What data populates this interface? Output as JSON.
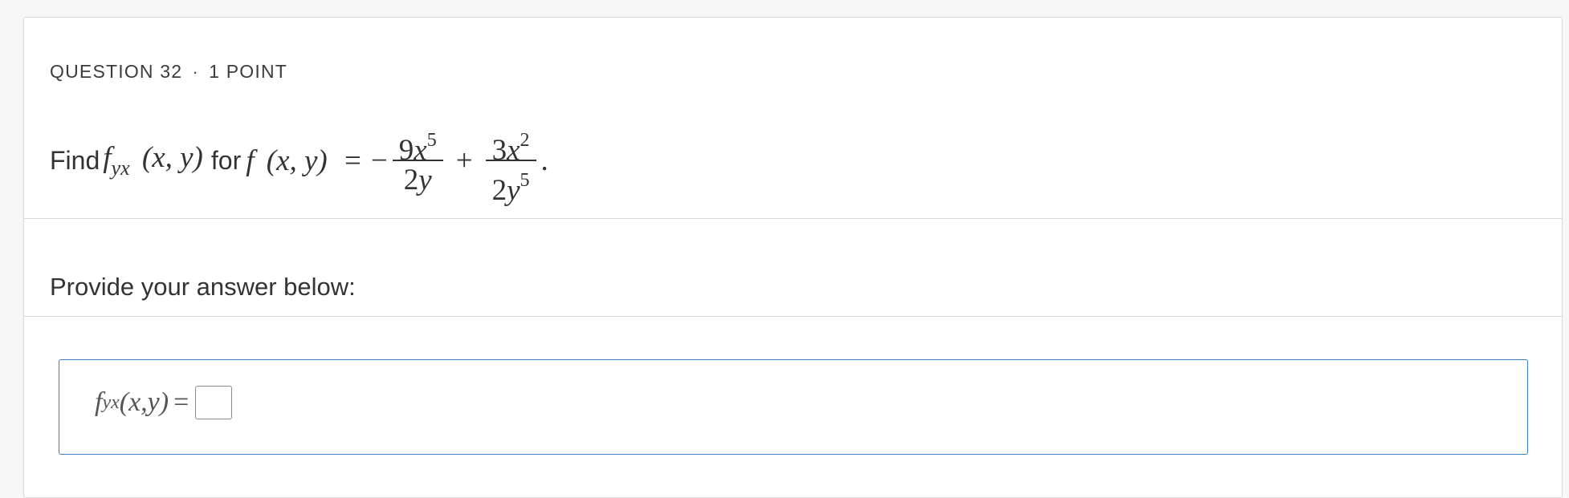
{
  "question": {
    "number_label": "QUESTION 32",
    "separator": "·",
    "points_label": "1 POINT"
  },
  "prompt": {
    "find_word": "Find",
    "target_fn": "f",
    "target_sub": "yx",
    "target_args": "(x, y)",
    "for_word": "for",
    "fn": "f",
    "fn_args": "(x, y)",
    "equals": "=",
    "minus": "−",
    "term1_num_coef": "9",
    "term1_num_var": "x",
    "term1_num_exp": "5",
    "term1_den_coef": "2",
    "term1_den_var": "y",
    "plus": "+",
    "term2_num_coef": "3",
    "term2_num_var": "x",
    "term2_num_exp": "2",
    "term2_den_coef": "2",
    "term2_den_var": "y",
    "term2_den_exp": "5",
    "period": "."
  },
  "answer_section": {
    "instruction": "Provide your answer below:",
    "lhs_fn": "f",
    "lhs_sub": "yx",
    "lhs_args": "(x,y)",
    "lhs_equals": "=",
    "input_value": ""
  },
  "colors": {
    "accent_border": "#3d7fc4",
    "text": "#333333",
    "divider": "#d8d8d8"
  }
}
